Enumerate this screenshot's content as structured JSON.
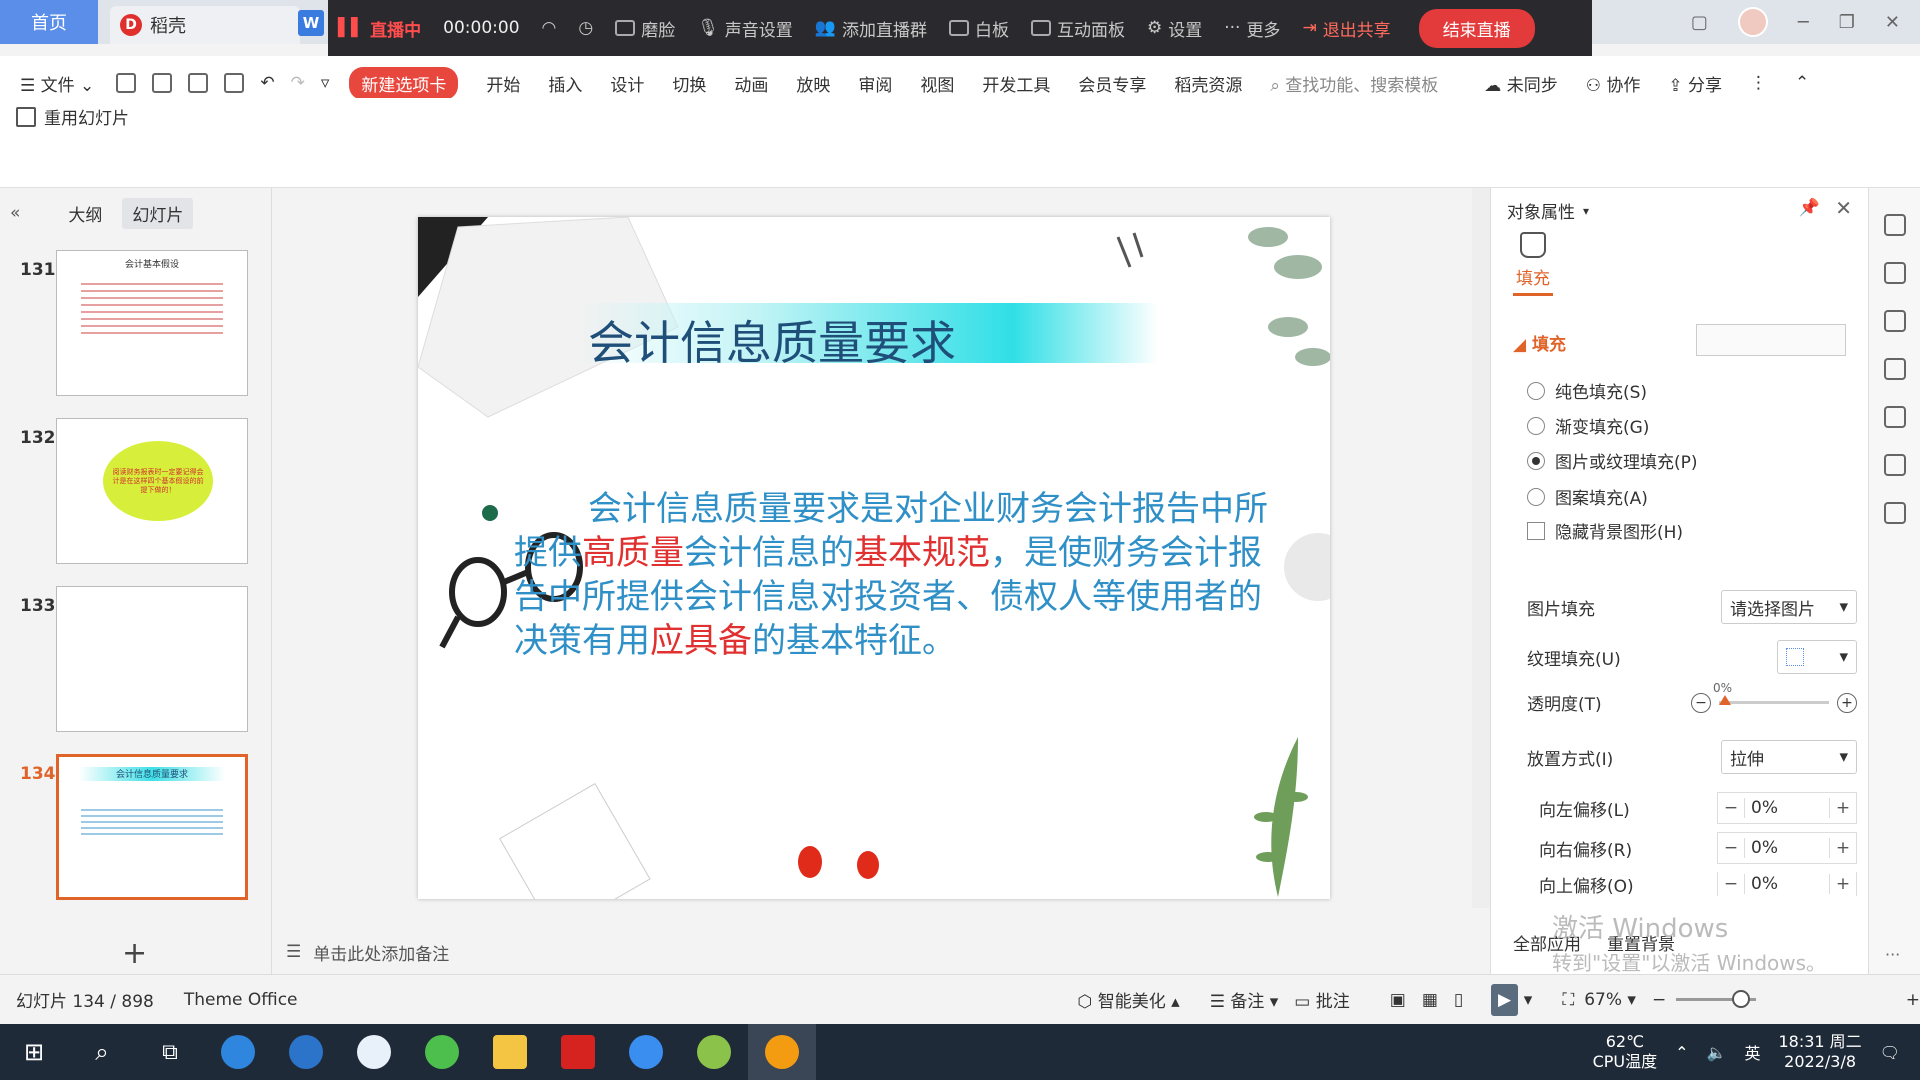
{
  "tabs": {
    "home": "首页",
    "daoke": "稻壳"
  },
  "livebar": {
    "live_label": "直播中",
    "time": "00:00:00",
    "beauty": "磨脸",
    "sound": "声音设置",
    "add_group": "添加直播群",
    "whiteboard": "白板",
    "interactive": "互动面板",
    "settings": "设置",
    "more": "更多",
    "exit_share": "退出共享",
    "end_live": "结束直播"
  },
  "menu": {
    "file": "文件",
    "new_tab": "新建选项卡",
    "items": [
      "开始",
      "插入",
      "设计",
      "切换",
      "动画",
      "放映",
      "审阅",
      "视图",
      "开发工具",
      "会员专享",
      "稻壳资源"
    ],
    "search_placeholder": "查找功能、搜索模板",
    "unsynced": "未同步",
    "collab": "协作",
    "share": "分享"
  },
  "ribbon": {
    "reuse": "重用幻灯片"
  },
  "leftpanel": {
    "tab_outline": "大纲",
    "tab_slides": "幻灯片",
    "thumbs": [
      {
        "num": "131",
        "title": "会计基本假设"
      },
      {
        "num": "132",
        "title": "阅读财务报表时一定要记得会计是在这样四个基本假设的前提下做的！"
      },
      {
        "num": "133",
        "title": ""
      },
      {
        "num": "134",
        "title": "会计信息质量要求"
      }
    ]
  },
  "slide": {
    "title": "会计信息质量要求",
    "body_parts": [
      {
        "text": "会计信息质量要求是对企业财务会计报告中所提供",
        "red": false
      },
      {
        "text": "高质量",
        "red": true
      },
      {
        "text": "会计信息的",
        "red": false
      },
      {
        "text": "基本规范",
        "red": true
      },
      {
        "text": "，是使财务会计报告中所提供会计信息对投资者、债权人等使用者的决策有用",
        "red": false
      },
      {
        "text": "应具备",
        "red": true
      },
      {
        "text": "的基本特征。",
        "red": false
      }
    ]
  },
  "notes": {
    "placeholder": "单击此处添加备注"
  },
  "rightpanel": {
    "title": "对象属性",
    "fill_tab": "填充",
    "fill_section": "填充",
    "options": [
      {
        "label": "纯色填充(S)",
        "checked": false
      },
      {
        "label": "渐变填充(G)",
        "checked": false
      },
      {
        "label": "图片或纹理填充(P)",
        "checked": true
      },
      {
        "label": "图案填充(A)",
        "checked": false
      }
    ],
    "hide_bg": "隐藏背景图形(H)",
    "pic_fill_label": "图片填充",
    "pic_fill_value": "请选择图片",
    "texture_label": "纹理填充(U)",
    "transparency_label": "透明度(T)",
    "transparency_value": "0%",
    "placement_label": "放置方式(I)",
    "placement_value": "拉伸",
    "offset_left_label": "向左偏移(L)",
    "offset_left_value": "0%",
    "offset_right_label": "向右偏移(R)",
    "offset_right_value": "0%",
    "offset_up_label": "向上偏移(O)",
    "offset_up_value": "0%",
    "apply_all": "全部应用",
    "reset_bg": "重置背景"
  },
  "watermark": {
    "line1": "激活 Windows",
    "line2": "转到\"设置\"以激活 Windows。"
  },
  "statusbar": {
    "slide_count": "幻灯片 134 / 898",
    "theme": "Theme Office",
    "beautify": "智能美化",
    "notes": "备注",
    "comments": "批注",
    "zoom": "67%"
  },
  "taskbar": {
    "temp": "62℃",
    "temp_label": "CPU温度",
    "ime": "英",
    "time": "18:31 周二",
    "date": "2022/3/8"
  },
  "colors": {
    "accent": "#e0642a",
    "live_red": "#e33b3b",
    "slide_blue": "#2f8fc7",
    "slide_red": "#e03030"
  }
}
